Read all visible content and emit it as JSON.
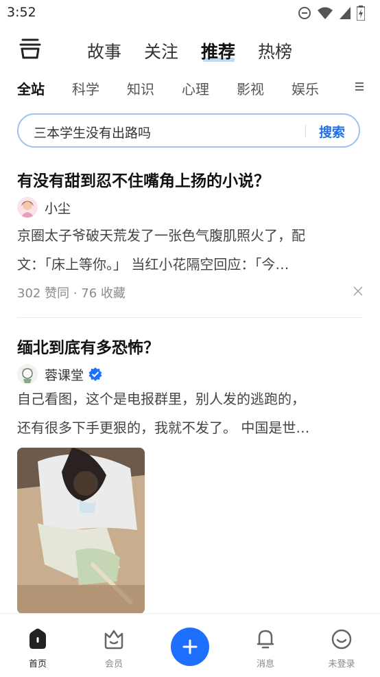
{
  "status_bar": {
    "time": "3:52"
  },
  "top_tabs": [
    {
      "label": "故事",
      "active": false
    },
    {
      "label": "关注",
      "active": false
    },
    {
      "label": "推荐",
      "active": true
    },
    {
      "label": "热榜",
      "active": false
    }
  ],
  "categories": [
    {
      "label": "全站",
      "active": true
    },
    {
      "label": "科学",
      "active": false
    },
    {
      "label": "知识",
      "active": false
    },
    {
      "label": "心理",
      "active": false
    },
    {
      "label": "影视",
      "active": false
    },
    {
      "label": "娱乐",
      "active": false
    }
  ],
  "search": {
    "query": "三本学生没有出路吗",
    "button_label": "搜索"
  },
  "feed": [
    {
      "title": "有没有甜到忍不住嘴角上扬的小说？",
      "author": "小尘",
      "excerpt_line1": "京圈太子爷破天荒发了一张色气腹肌照火了，配",
      "excerpt_line2": "文：「床上等你。」 当红小花隔空回应：「今…",
      "meta": "302 赞同 · 76 收藏"
    },
    {
      "title": "缅北到底有多恐怖？",
      "author": "蓉课堂",
      "verified": true,
      "excerpt_line1": "自己看图，这个是电报群里，别人发的逃跑的，",
      "excerpt_line2": "还有很多下手更狠的，我就不发了。 中国是世…"
    }
  ],
  "bottom_nav": [
    {
      "label": "首页",
      "icon": "home-icon",
      "active": true
    },
    {
      "label": "会员",
      "icon": "vip-icon",
      "active": false
    },
    {
      "label": "",
      "icon": "plus-icon",
      "active": false
    },
    {
      "label": "消息",
      "icon": "bell-icon",
      "active": false
    },
    {
      "label": "未登录",
      "icon": "profile-icon",
      "active": false
    }
  ],
  "colors": {
    "accent": "#1f6fff",
    "search_border": "#9cc2ef",
    "tab_underline": "#bcd9f7"
  }
}
